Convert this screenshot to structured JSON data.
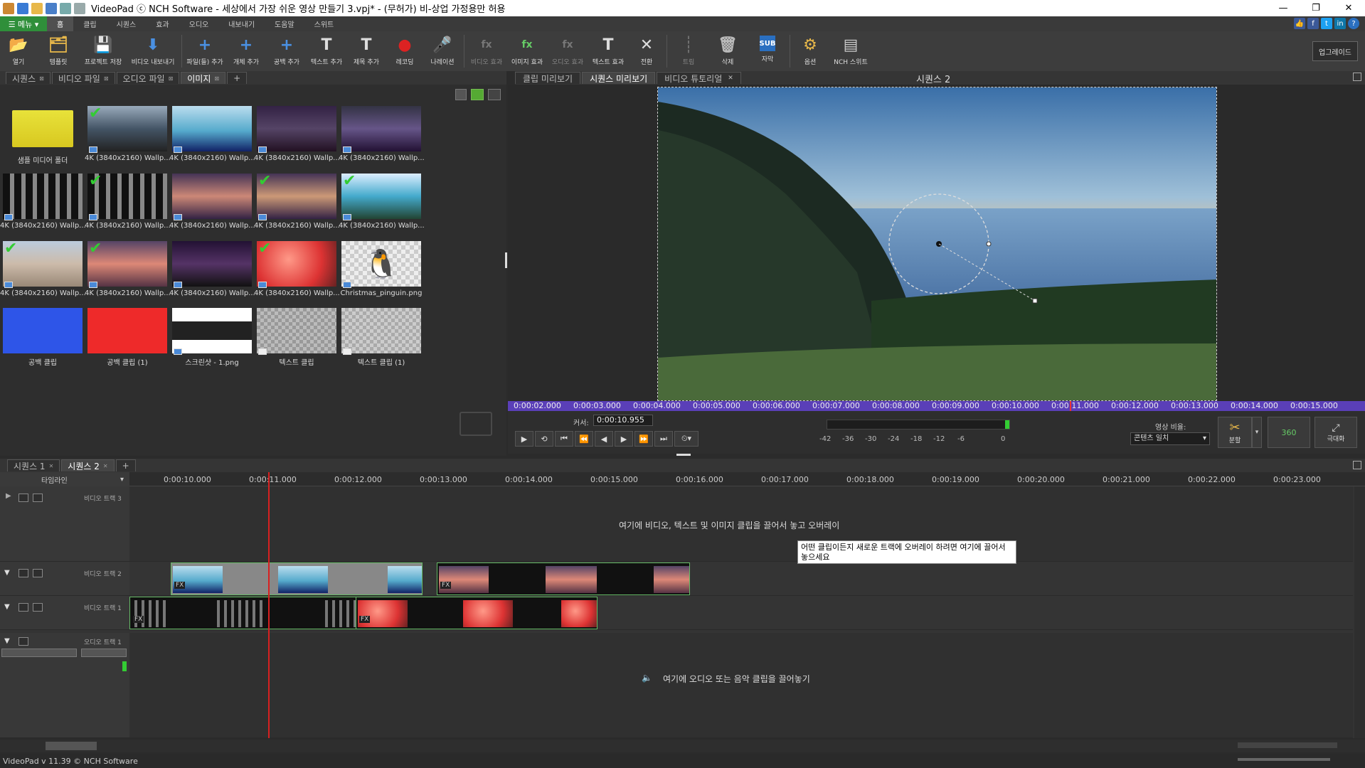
{
  "window": {
    "title": "VideoPad ⓒ NCH Software - 세상에서 가장 쉬운 영상 만들기 3.vpj* - (무허가) 비-상업 가정용만 허용",
    "minimize": "—",
    "restore": "❐",
    "close": "✕"
  },
  "menu": {
    "menu_button": "☰ 메뉴 ▾",
    "tabs": [
      "홈",
      "클립",
      "시퀀스",
      "효과",
      "오디오",
      "내보내기",
      "도움말",
      "스위트"
    ]
  },
  "toolbar": {
    "items": [
      {
        "label": "열기",
        "glyph": "📂"
      },
      {
        "label": "템플릿",
        "glyph": "🗂"
      },
      {
        "label": "프로젝트 저장",
        "glyph": "💾"
      },
      {
        "label": "비디오 내보내기",
        "glyph": "⬇"
      },
      {
        "label": "파일(들) 추가",
        "glyph": "+"
      },
      {
        "label": "개체 추가",
        "glyph": "+"
      },
      {
        "label": "공백 추가",
        "glyph": "+"
      },
      {
        "label": "텍스트 추가",
        "glyph": "T"
      },
      {
        "label": "제목 추가",
        "glyph": "T"
      },
      {
        "label": "레코딩",
        "glyph": "●"
      },
      {
        "label": "나레이션",
        "glyph": "🎤"
      },
      {
        "label": "비디오 효과",
        "glyph": "fx"
      },
      {
        "label": "이미지 효과",
        "glyph": "fx"
      },
      {
        "label": "오디오 효과",
        "glyph": "fx"
      },
      {
        "label": "텍스트 효과",
        "glyph": "T"
      },
      {
        "label": "전환",
        "glyph": "✕"
      },
      {
        "label": "트림",
        "glyph": "┊"
      },
      {
        "label": "삭제",
        "glyph": "🗑"
      },
      {
        "label": "자막",
        "glyph": "SUB"
      },
      {
        "label": "옵션",
        "glyph": "⚙"
      },
      {
        "label": "NCH 스위트",
        "glyph": "▤"
      }
    ],
    "upgrade": "업그레이드"
  },
  "media": {
    "tabs": [
      {
        "label": "시퀀스",
        "close": "⊠"
      },
      {
        "label": "비디오 파일",
        "close": "⊠"
      },
      {
        "label": "오디오 파일",
        "close": "⊠"
      },
      {
        "label": "이미지",
        "close": "⊠"
      }
    ],
    "add_tab": "+",
    "items": [
      "샘플 미디어 폴더",
      "4K (3840x2160) Wallp...",
      "4K (3840x2160) Wallp...",
      "4K (3840x2160) Wallp...",
      "4K (3840x2160) Wallp...",
      "4K (3840x2160) Wallp...",
      "4K (3840x2160) Wallp...",
      "4K (3840x2160) Wallp...",
      "4K (3840x2160) Wallp...",
      "4K (3840x2160) Wallp...",
      "4K (3840x2160) Wallp...",
      "4K (3840x2160) Wallp...",
      "4K (3840x2160) Wallp...",
      "4K (3840x2160) Wallp...",
      "Christmas_pinguin.png",
      "공백 클립",
      "공백 클립 (1)",
      "스크린샷 - 1.png",
      "텍스트 클립",
      "텍스트 클립 (1)"
    ]
  },
  "preview": {
    "tabs": [
      {
        "label": "클립 미리보기",
        "close": ""
      },
      {
        "label": "시퀀스 미리보기",
        "close": ""
      },
      {
        "label": "비디오 튜토리얼",
        "close": "✕"
      }
    ],
    "sequence_name": "시퀀스 2",
    "ruler": [
      "0:00:02.000",
      "0:00:03.000",
      "0:00:04.000",
      "0:00:05.000",
      "0:00:06.000",
      "0:00:07.000",
      "0:00:08.000",
      "0:00:09.000",
      "0:00:10.000",
      "0:00:11.000",
      "0:00:12.000",
      "0:00:13.000",
      "0:00:14.000",
      "0:00:15.000"
    ],
    "cursor_label": "커서:",
    "cursor_value": "0:00:10.955",
    "meter_labels": [
      "-42",
      "-36",
      "-30",
      "-24",
      "-18",
      "-12",
      "-6",
      "0"
    ],
    "aspect_label": "영상 비율:",
    "aspect_value": "콘텐츠 일치",
    "split_label": "분할",
    "btn_360": "360",
    "maximize_label": "극대화"
  },
  "timeline": {
    "tabs": [
      {
        "label": "시퀀스 1",
        "close": "✕"
      },
      {
        "label": "시퀀스 2",
        "close": "✕"
      }
    ],
    "add_tab": "+",
    "mode": "타임라인",
    "ruler": [
      "0:00:10.000",
      "0:00:11.000",
      "0:00:12.000",
      "0:00:13.000",
      "0:00:14.000",
      "0:00:15.000",
      "0:00:16.000",
      "0:00:17.000",
      "0:00:18.000",
      "0:00:19.000",
      "0:00:20.000",
      "0:00:21.000",
      "0:00:22.000",
      "0:00:23.000"
    ],
    "tracks": {
      "video3": "비디오 트랙 3",
      "video2": "비디오 트랙 2",
      "video1": "비디오 트랙 1",
      "audio1": "오디오 트랙 1"
    },
    "overlay_hint": "여기에 비디오, 텍스트 및 이미지 클립을 끌어서 놓고 오버레이",
    "tooltip": "어떤 클립이든지 새로운 트랙에 오버레이 하려면 여기에 끌어서 놓으세요",
    "audio_hint": "여기에 오디오 또는 음악 클립을 끌어놓기"
  },
  "status": {
    "text": "VideoPad v 11.39 © NCH Software"
  }
}
